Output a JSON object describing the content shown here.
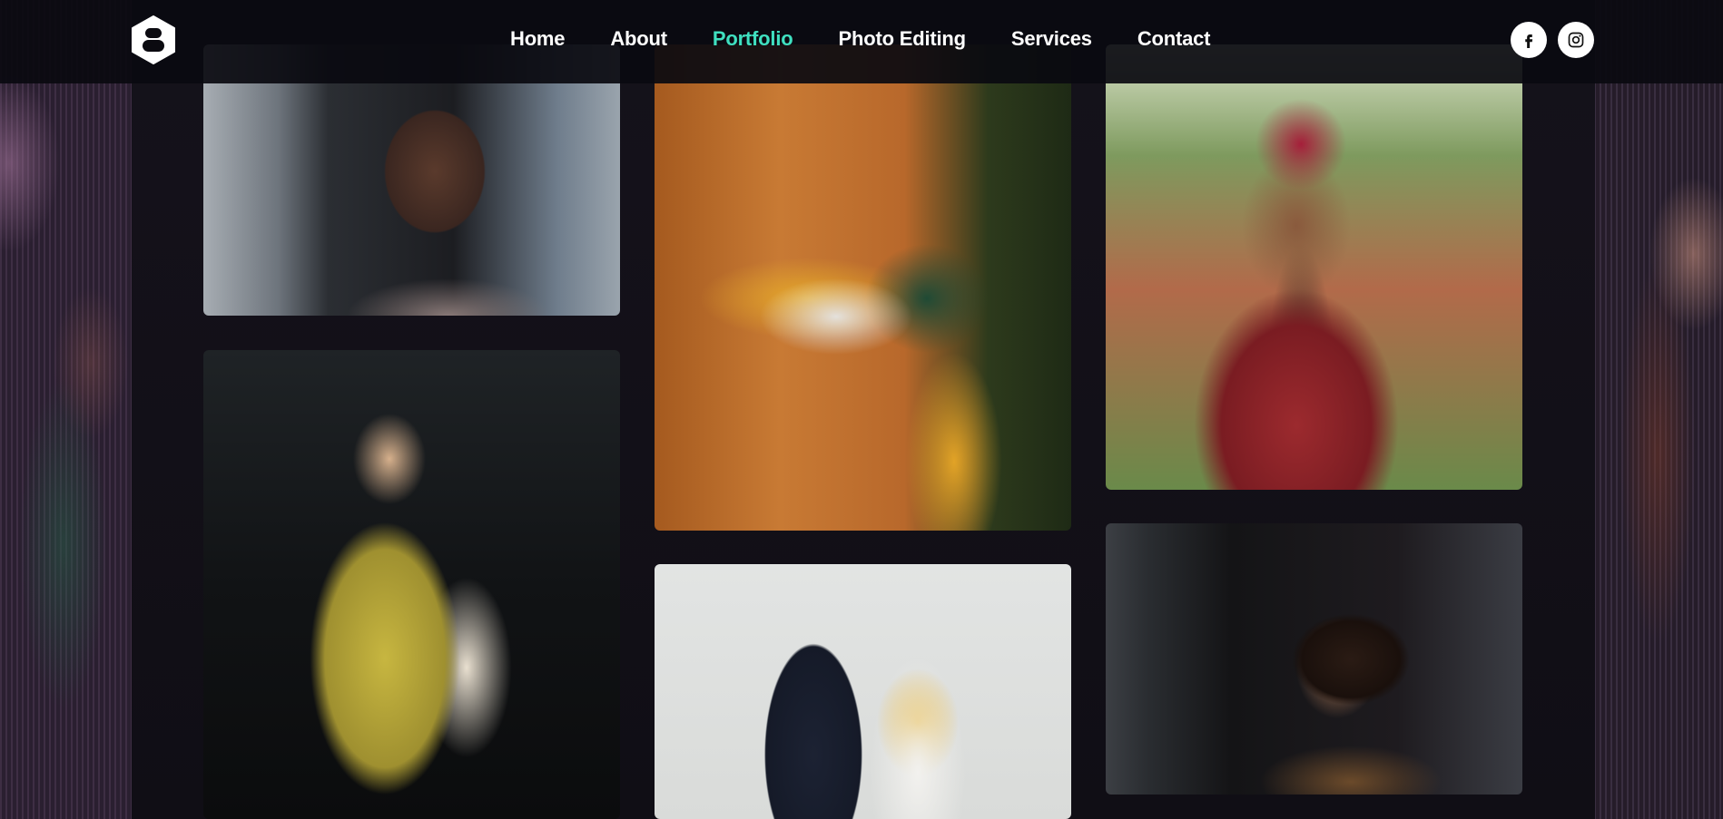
{
  "nav": {
    "items": [
      {
        "label": "Home",
        "active": false
      },
      {
        "label": "About",
        "active": false
      },
      {
        "label": "Portfolio",
        "active": true
      },
      {
        "label": "Photo Editing",
        "active": false
      },
      {
        "label": "Services",
        "active": false
      },
      {
        "label": "Contact",
        "active": false
      }
    ]
  },
  "social": {
    "icons": [
      "facebook-icon",
      "instagram-icon"
    ]
  },
  "colors": {
    "accent": "#3fe0c0",
    "nav_text": "#ffffff",
    "header_bg": "#0a0a10",
    "page_bg": "#0b0a10"
  },
  "gallery": {
    "photos": [
      {
        "subject": "woman in car"
      },
      {
        "subject": "person leaning on wooden door"
      },
      {
        "subject": "graduate in red gown"
      },
      {
        "subject": "woman in yellow dress with tote bag"
      },
      {
        "subject": "couple with sunflower bouquet"
      },
      {
        "subject": "woman dancing at party"
      }
    ]
  }
}
